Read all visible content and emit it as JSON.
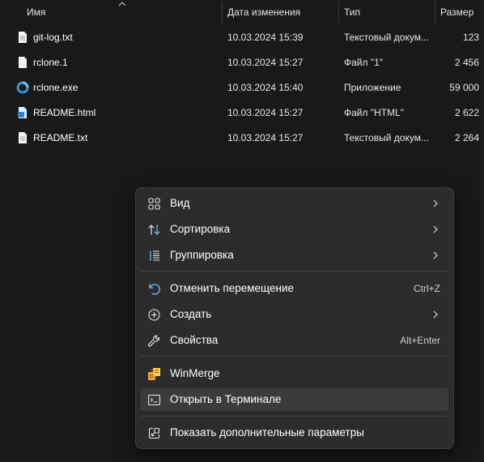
{
  "columns": {
    "name": "Имя",
    "date": "Дата изменения",
    "type": "Тип",
    "size": "Размер"
  },
  "files": [
    {
      "name": "git-log.txt",
      "date": "10.03.2024 15:39",
      "type": "Текстовый докум...",
      "size": "123",
      "icon": "text-file-icon"
    },
    {
      "name": "rclone.1",
      "date": "10.03.2024 15:27",
      "type": "Файл \"1\"",
      "size": "2 456",
      "icon": "generic-file-icon"
    },
    {
      "name": "rclone.exe",
      "date": "10.03.2024 15:40",
      "type": "Приложение",
      "size": "59 000",
      "icon": "rclone-app-icon"
    },
    {
      "name": "README.html",
      "date": "10.03.2024 15:27",
      "type": "Файл \"HTML\"",
      "size": "2 622",
      "icon": "html-file-icon"
    },
    {
      "name": "README.txt",
      "date": "10.03.2024 15:27",
      "type": "Текстовый докум...",
      "size": "2 264",
      "icon": "text-file-icon"
    }
  ],
  "menu": {
    "view": "Вид",
    "sort": "Сортировка",
    "group": "Группировка",
    "undo": "Отменить перемещение",
    "undo_shortcut": "Ctrl+Z",
    "create": "Создать",
    "properties": "Свойства",
    "properties_shortcut": "Alt+Enter",
    "winmerge": "WinMerge",
    "terminal": "Открыть в Терминале",
    "more": "Показать дополнительные параметры"
  },
  "colors": {
    "background": "#191919",
    "menu": "#2c2c2c",
    "highlight": "#3b3b3b",
    "accent": "#60cdff"
  }
}
